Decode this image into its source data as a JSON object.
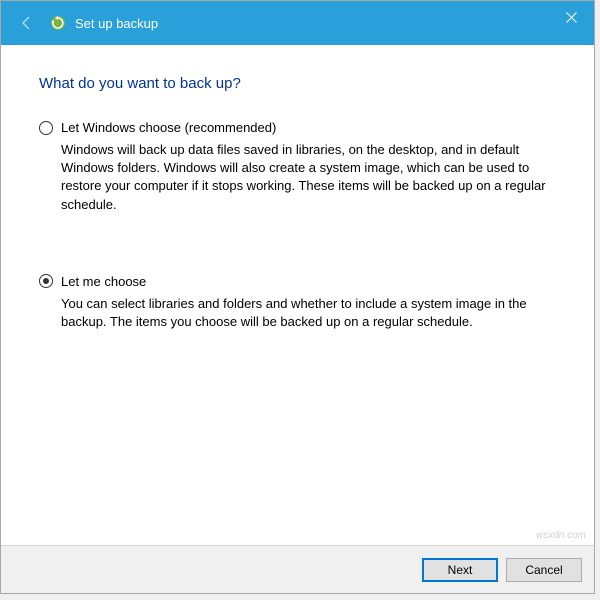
{
  "titlebar": {
    "title": "Set up backup"
  },
  "heading": "What do you want to back up?",
  "options": [
    {
      "label": "Let Windows choose (recommended)",
      "description": "Windows will back up data files saved in libraries, on the desktop, and in default Windows folders. Windows will also create a system image, which can be used to restore your computer if it stops working. These items will be backed up on a regular schedule.",
      "selected": false
    },
    {
      "label": "Let me choose",
      "description": "You can select libraries and folders and whether to include a system image in the backup. The items you choose will be backed up on a regular schedule.",
      "selected": true
    }
  ],
  "buttons": {
    "next": "Next",
    "cancel": "Cancel"
  },
  "watermark": "wsxdn.com"
}
